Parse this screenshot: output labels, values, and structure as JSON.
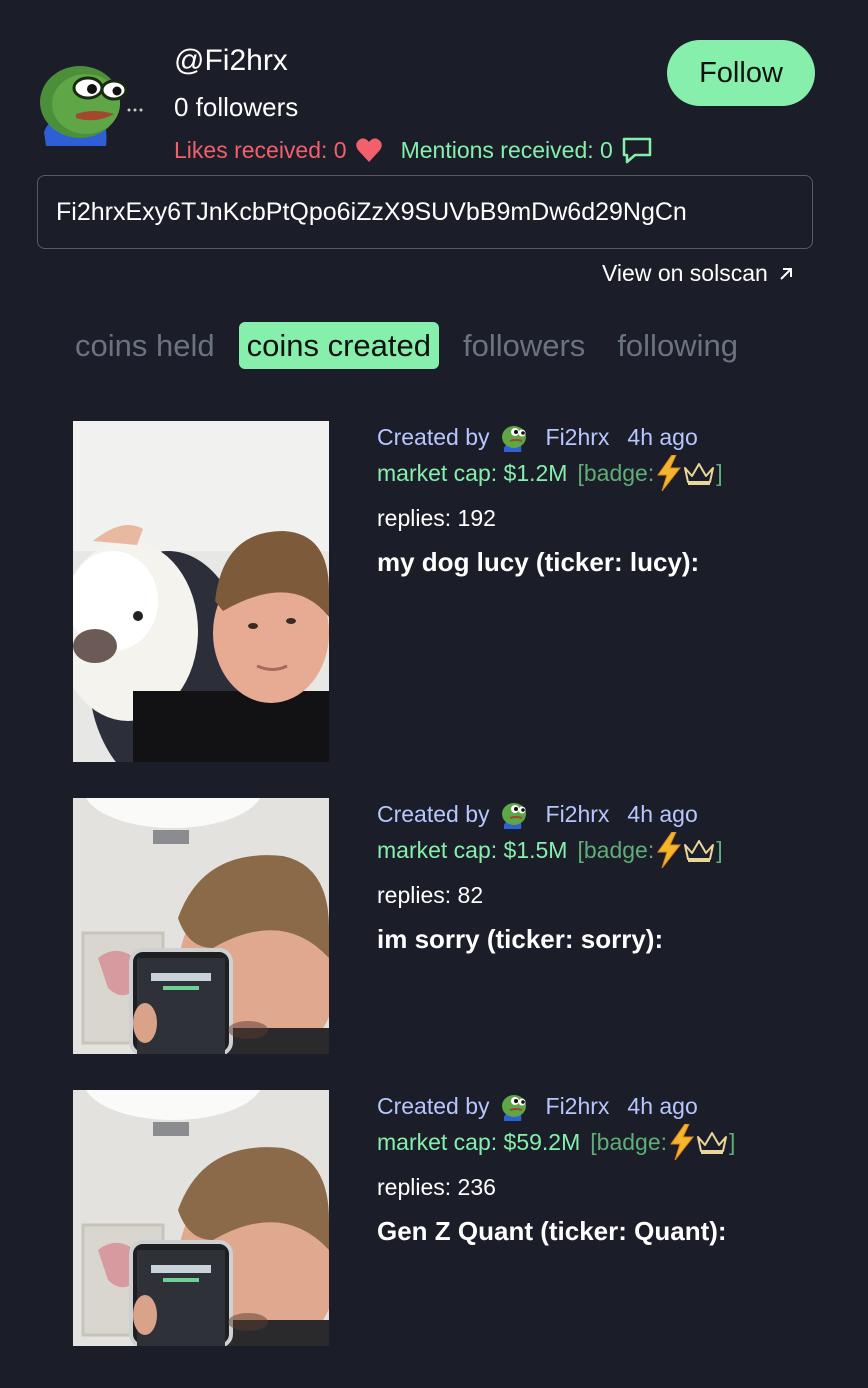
{
  "profile": {
    "handle": "@Fi2hrx",
    "followers": "0 followers",
    "likes": "Likes received: 0",
    "mentions": "Mentions received: 0",
    "follow_label": "Follow",
    "address": "Fi2hrxExy6TJnKcbPtQpo6iZzX9SUVbB9mDw6d29NgCn",
    "solscan_label": "View on solscan"
  },
  "tabs": [
    {
      "label": "coins held",
      "active": false
    },
    {
      "label": "coins created",
      "active": true
    },
    {
      "label": "followers",
      "active": false
    },
    {
      "label": "following",
      "active": false
    }
  ],
  "coins": [
    {
      "created_by": "Created by",
      "creator": "Fi2hrx",
      "time": "4h ago",
      "market_cap": "market cap: $1.2M",
      "badge_label": "[badge:",
      "badge_close": "]",
      "replies": "replies: 192",
      "name": "my dog lucy (ticker: lucy):"
    },
    {
      "created_by": "Created by",
      "creator": "Fi2hrx",
      "time": "4h ago",
      "market_cap": "market cap: $1.5M",
      "badge_label": "[badge:",
      "badge_close": "]",
      "replies": "replies: 82",
      "name": "im sorry (ticker: sorry):"
    },
    {
      "created_by": "Created by",
      "creator": "Fi2hrx",
      "time": "4h ago",
      "market_cap": "market cap: $59.2M",
      "badge_label": "[badge:",
      "badge_close": "]",
      "replies": "replies: 236",
      "name": "Gen Z Quant (ticker: Quant):"
    }
  ],
  "colors": {
    "background": "#1b1d28",
    "accent": "#86efac",
    "likes": "#f2606c",
    "creator": "#b8c6ff"
  }
}
